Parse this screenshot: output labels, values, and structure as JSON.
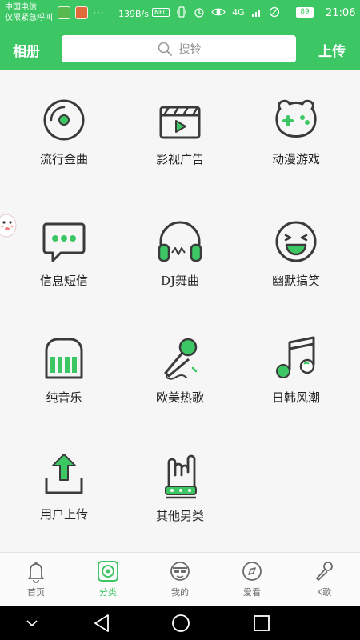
{
  "status_bar": {
    "carrier_line1": "中国电信",
    "carrier_line2": "仅限紧急呼叫",
    "more": "···",
    "net_speed": "139B/s",
    "nfc": "NFC",
    "signal": "4G",
    "battery": "89",
    "time": "21:06"
  },
  "header": {
    "album_label": "相册",
    "search_placeholder": "搜铃",
    "upload_label": "上传"
  },
  "categories": [
    {
      "label": "流行金曲",
      "icon": "vinyl-disc-icon"
    },
    {
      "label": "影视广告",
      "icon": "clapperboard-play-icon"
    },
    {
      "label": "动漫游戏",
      "icon": "bear-gamepad-icon"
    },
    {
      "label": "信息短信",
      "icon": "chat-bubble-icon"
    },
    {
      "label": "DJ舞曲",
      "icon": "headphones-icon"
    },
    {
      "label": "幽默搞笑",
      "icon": "laughing-face-icon"
    },
    {
      "label": "纯音乐",
      "icon": "piano-icon"
    },
    {
      "label": "欧美热歌",
      "icon": "microphone-icon"
    },
    {
      "label": "日韩风潮",
      "icon": "music-note-icon"
    },
    {
      "label": "用户上传",
      "icon": "upload-tray-icon"
    },
    {
      "label": "其他另类",
      "icon": "rock-hand-icon"
    }
  ],
  "tabs": [
    {
      "label": "首页",
      "icon": "bell-icon",
      "active": false
    },
    {
      "label": "分类",
      "icon": "disc-square-icon",
      "active": true
    },
    {
      "label": "我的",
      "icon": "user-avatar-icon",
      "active": false
    },
    {
      "label": "爱看",
      "icon": "compass-icon",
      "active": false
    },
    {
      "label": "K歌",
      "icon": "karaoke-mic-icon",
      "active": false
    }
  ],
  "colors": {
    "accent": "#3dc764",
    "icon_stroke": "#3a3a3a"
  }
}
